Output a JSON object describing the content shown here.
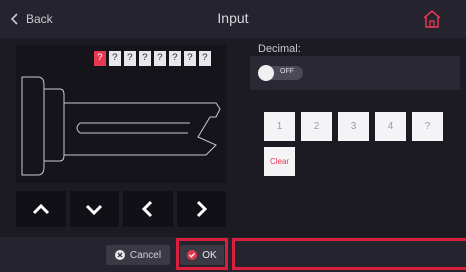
{
  "header": {
    "back_label": "Back",
    "title": "Input"
  },
  "code_digits": [
    "?",
    "?",
    "?",
    "?",
    "?",
    "?",
    "?",
    "?"
  ],
  "decimal": {
    "label": "Decimal:",
    "toggle_label": "OFF",
    "enabled": false
  },
  "keypad": {
    "keys": [
      "1",
      "2",
      "3",
      "4",
      "?"
    ],
    "clear_label": "Clear"
  },
  "footer": {
    "cancel_label": "Cancel",
    "ok_label": "OK"
  },
  "colors": {
    "accent": "#e53950",
    "highlight": "#d81f3c",
    "background": "#1c1b24"
  }
}
